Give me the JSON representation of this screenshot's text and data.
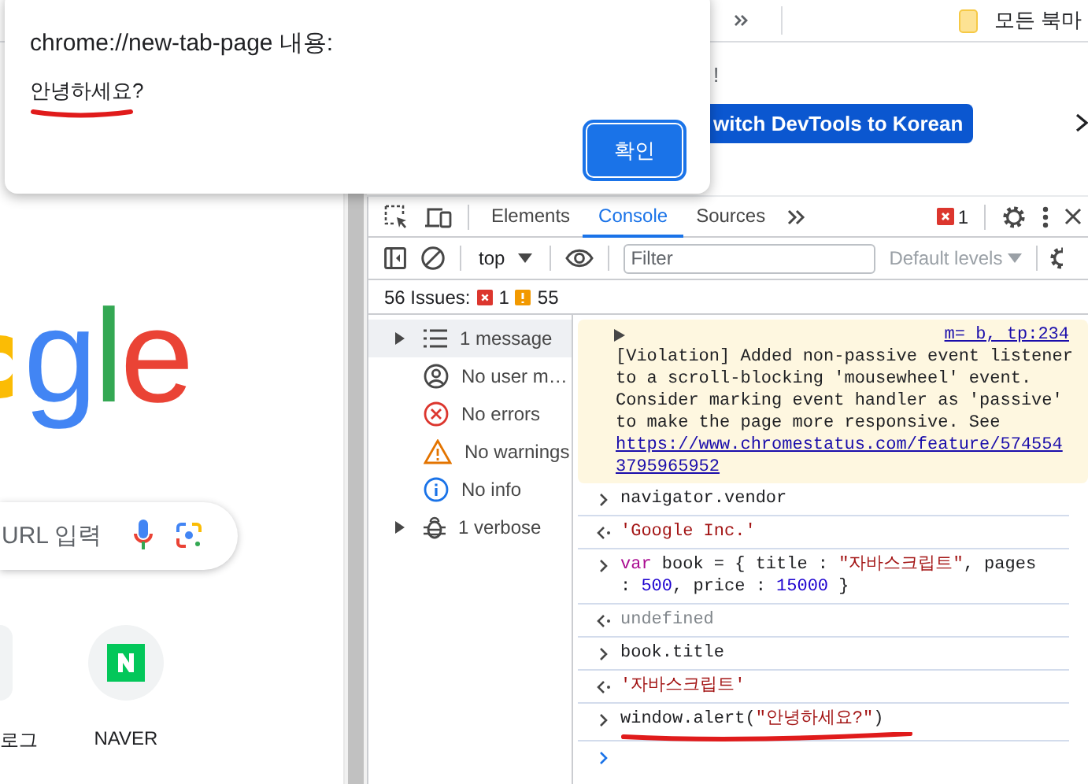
{
  "bookmark_bar": {
    "folder": "모든 북마"
  },
  "infobar": {
    "text_end": "!",
    "button": "witch DevTools to Korean"
  },
  "new_tab_page": {
    "logo": "gle",
    "search": {
      "placeholder": "URL 입력"
    },
    "shortcuts": [
      {
        "label": "로그",
        "kind": "partial"
      },
      {
        "label": "NAVER",
        "kind": "naver"
      }
    ]
  },
  "devtools": {
    "tabs": [
      {
        "label": "Elements",
        "selected": false
      },
      {
        "label": "Console",
        "selected": true
      },
      {
        "label": "Sources",
        "selected": false
      }
    ],
    "error_count": "1",
    "context": "top",
    "filter": {
      "placeholder": "Filter"
    },
    "levels": "Default levels",
    "issues": {
      "label": "56 Issues:",
      "errors": "1",
      "warnings": "55"
    },
    "sidebar": [
      {
        "label": "1 message",
        "kind": "messages",
        "selected": true,
        "expandable": true
      },
      {
        "label": "No user m…",
        "kind": "user",
        "selected": false,
        "expandable": false
      },
      {
        "label": "No errors",
        "kind": "errors",
        "selected": false,
        "expandable": false
      },
      {
        "label": "No warnings",
        "kind": "warnings",
        "selected": false,
        "expandable": false
      },
      {
        "label": "No info",
        "kind": "info",
        "selected": false,
        "expandable": false
      },
      {
        "label": "1 verbose",
        "kind": "verbose",
        "selected": false,
        "expandable": true
      }
    ],
    "console": [
      {
        "kind": "violation",
        "text": "[Violation] Added non-passive event listener to a scroll-blocking 'mousewheel' event. Consider marking event handler as 'passive' to make the page more responsive. See",
        "link": "https://www.chromestatus.com/feature/5745543795965952",
        "source": "m= b, tp:234"
      },
      {
        "kind": "input",
        "underlined": false,
        "segments": [
          {
            "text": "navigator.vendor",
            "kind": "plain"
          }
        ]
      },
      {
        "kind": "output",
        "underlined": false,
        "segments": [
          {
            "text": "'Google Inc.'",
            "kind": "string"
          }
        ]
      },
      {
        "kind": "input",
        "underlined": false,
        "segments": [
          {
            "text": "var",
            "kind": "keyword"
          },
          {
            "text": " book = { title : ",
            "kind": "plain"
          },
          {
            "text": "\"자바스크립트\"",
            "kind": "string"
          },
          {
            "text": ", pages : ",
            "kind": "plain"
          },
          {
            "text": "500",
            "kind": "number"
          },
          {
            "text": ", price : ",
            "kind": "plain"
          },
          {
            "text": "15000",
            "kind": "number"
          },
          {
            "text": " }",
            "kind": "plain"
          }
        ]
      },
      {
        "kind": "output",
        "underlined": false,
        "segments": [
          {
            "text": "undefined",
            "kind": "undefined"
          }
        ]
      },
      {
        "kind": "input",
        "underlined": false,
        "segments": [
          {
            "text": "book.title",
            "kind": "plain"
          }
        ]
      },
      {
        "kind": "output",
        "underlined": false,
        "segments": [
          {
            "text": "'자바스크립트'",
            "kind": "string"
          }
        ]
      },
      {
        "kind": "input",
        "underlined": true,
        "segments": [
          {
            "text": "window.alert(",
            "kind": "plain"
          },
          {
            "text": "\"안녕하세요?\"",
            "kind": "string"
          },
          {
            "text": ")",
            "kind": "plain"
          }
        ]
      },
      {
        "kind": "prompt"
      }
    ]
  },
  "dialog": {
    "title": "chrome://new-tab-page 내용:",
    "message": "안녕하세요?",
    "underlined": true,
    "button": "확인"
  }
}
